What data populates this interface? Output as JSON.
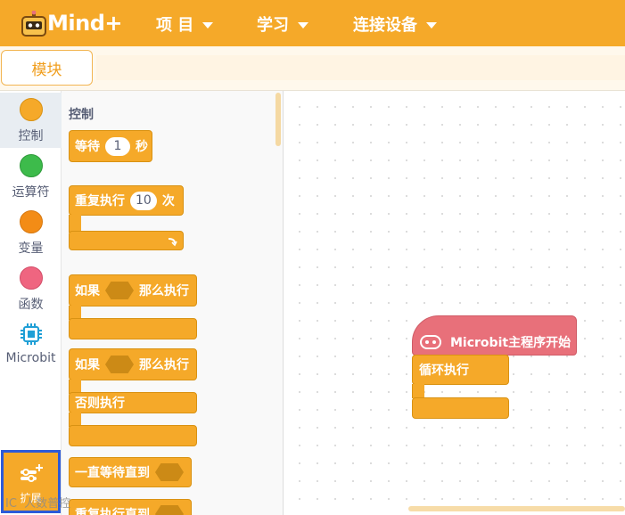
{
  "app": {
    "logo_text": "Mind+"
  },
  "nav": [
    {
      "label": "项 目"
    },
    {
      "label": "学习"
    },
    {
      "label": "连接设备"
    }
  ],
  "tabs": {
    "modules": "模块"
  },
  "categories": [
    {
      "label": "控制",
      "color": "#f5a929"
    },
    {
      "label": "运算符",
      "color": "#3dbb4b"
    },
    {
      "label": "变量",
      "color": "#f38c16"
    },
    {
      "label": "函数",
      "color": "#ef6580"
    },
    {
      "label": "Microbit",
      "color": "#1f9fd6"
    }
  ],
  "extension": {
    "label": "扩展"
  },
  "palette": {
    "title": "控制",
    "blocks": {
      "wait": {
        "label": "等待",
        "value": "1",
        "unit": "秒"
      },
      "repeat": {
        "label": "重复执行",
        "value": "10",
        "unit": "次"
      },
      "if_then": {
        "if": "如果",
        "then": "那么执行"
      },
      "if_else": {
        "if": "如果",
        "then": "那么执行",
        "else": "否则执行"
      },
      "wait_until": {
        "label": "一直等待直到"
      },
      "repeat_until": {
        "label": "重复执行直到"
      }
    }
  },
  "workspace": {
    "hat_label": "Microbit主程序开始",
    "loop_label": "循环执行"
  },
  "watermark": "IC  人数普控",
  "colors": {
    "accent": "#f5a929",
    "hat": "#e8707a",
    "selection_border": "#2c5ad8"
  }
}
